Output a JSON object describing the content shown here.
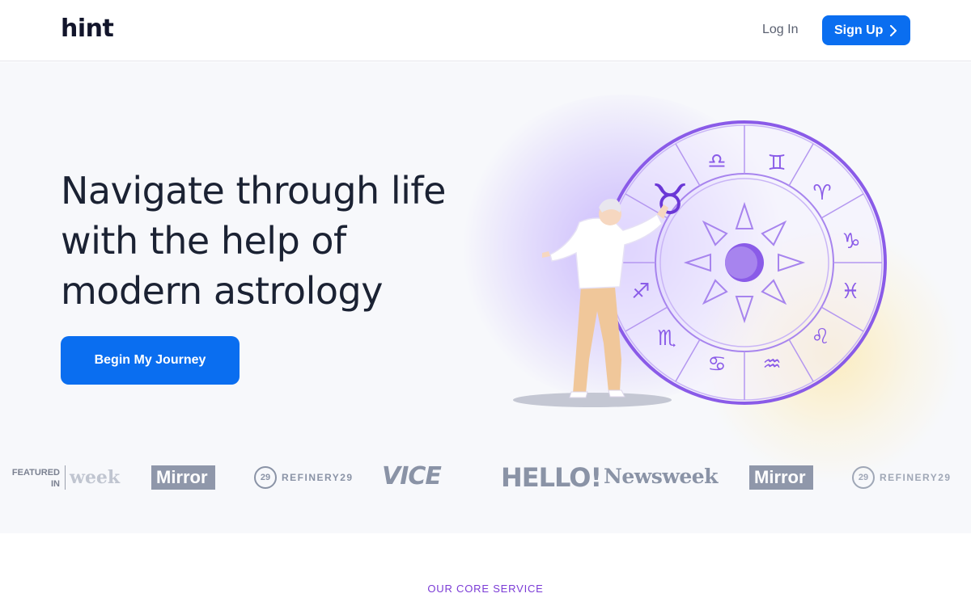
{
  "header": {
    "logo": "hint",
    "login_label": "Log In",
    "signup_label": "Sign Up"
  },
  "hero": {
    "headline": "Navigate through life with the help of modern astrology",
    "cta_label": "Begin My Journey"
  },
  "press": {
    "featured_label": "FEATURED IN",
    "logos": [
      "week",
      "Mirror",
      "REFINERY29",
      "VICE",
      "HELLO!",
      "Newsweek",
      "Mirror",
      "REFINERY29"
    ],
    "refinery_mark": "29"
  },
  "core_service": {
    "label": "OUR CORE SERVICE"
  },
  "colors": {
    "accent": "#0a6ef0",
    "purple": "#7b3bd6",
    "hero_bg": "#f7f8fb",
    "text_dark": "#1b2233"
  },
  "icons": [
    "chevron-right-icon",
    "zodiac-wheel-icon",
    "person-illustration"
  ]
}
